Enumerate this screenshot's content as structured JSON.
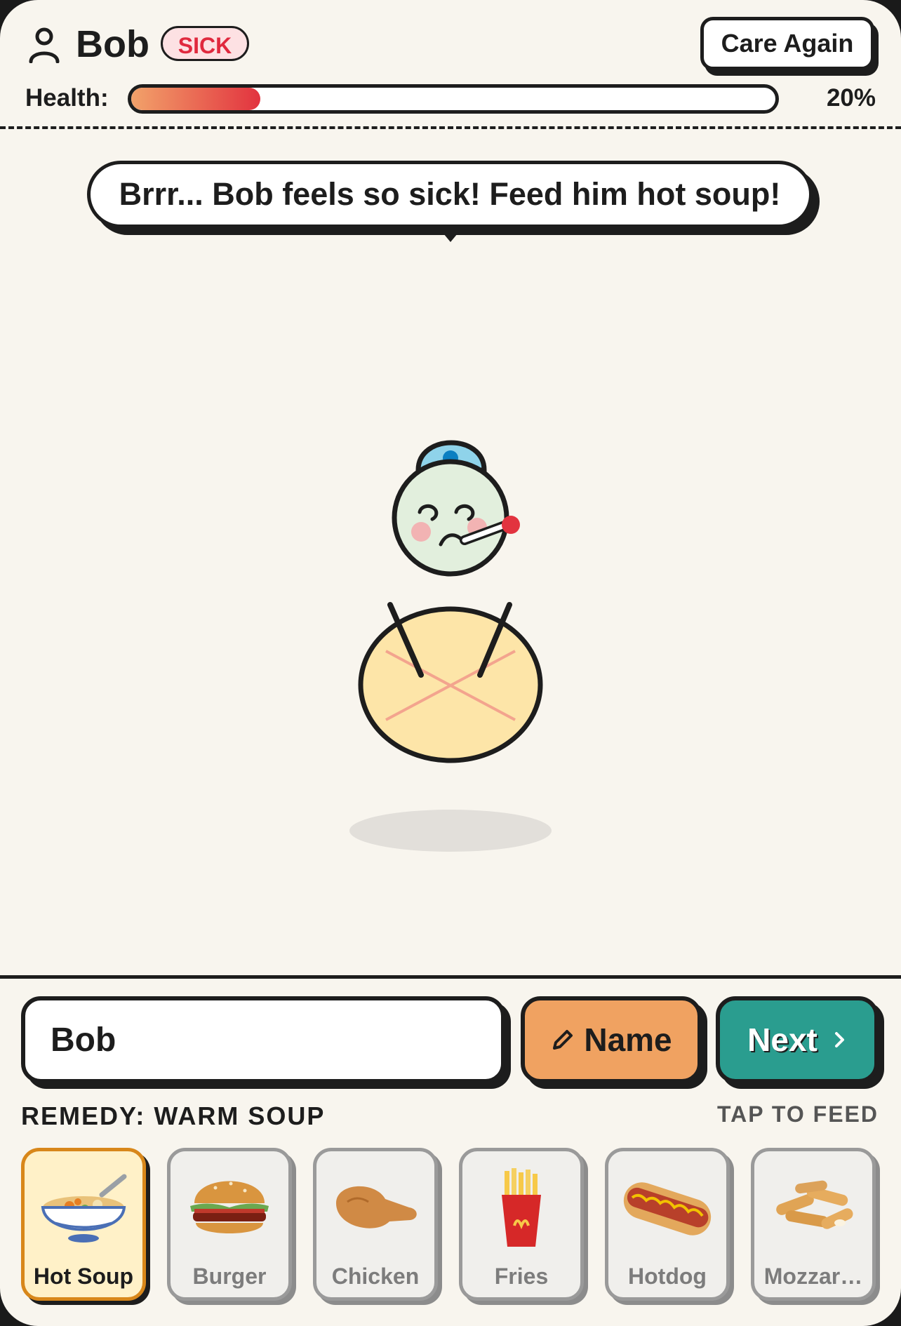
{
  "header": {
    "pet_name": "Bob",
    "status_badge": "SICK",
    "care_button": "Care Again",
    "health_label": "Health:",
    "health_value_text": "20%",
    "health_fraction": 0.2
  },
  "speech": {
    "text": "Brrr... Bob feels so sick! Feed him hot soup!"
  },
  "controls": {
    "name_input_value": "Bob",
    "name_button": "Name",
    "next_button": "Next"
  },
  "feed": {
    "remedy_label": "REMEDY: WARM SOUP",
    "tap_label": "TAP TO FEED",
    "foods": [
      {
        "label": "Hot Soup",
        "icon": "soup-icon",
        "selected": true
      },
      {
        "label": "Burger",
        "icon": "burger-icon",
        "selected": false
      },
      {
        "label": "Chicken",
        "icon": "chicken-leg-icon",
        "selected": false
      },
      {
        "label": "Fries",
        "icon": "fries-icon",
        "selected": false
      },
      {
        "label": "Hotdog",
        "icon": "hotdog-icon",
        "selected": false
      },
      {
        "label": "Mozzar…",
        "icon": "mozzarella-sticks-icon",
        "selected": false
      }
    ]
  },
  "colors": {
    "accent_orange": "#f0a261",
    "accent_teal": "#2a9d8f",
    "sick_red": "#e0293e",
    "background": "#f8f5ee"
  }
}
